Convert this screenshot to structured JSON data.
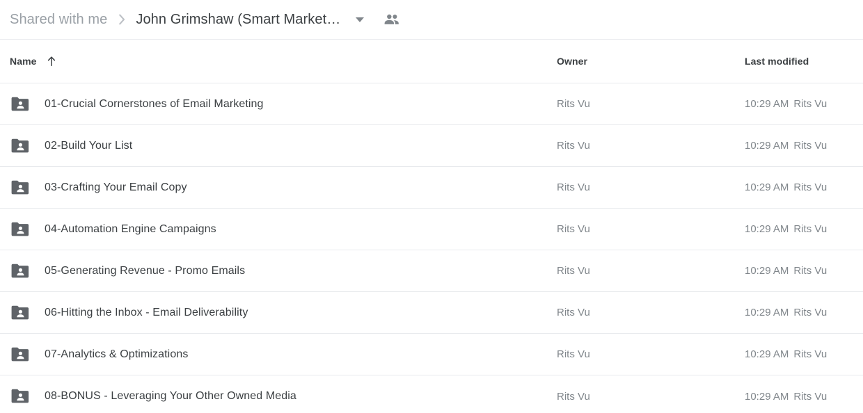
{
  "breadcrumb": {
    "root_label": "Shared with me",
    "separator_icon": "chevron-right-icon",
    "current_label": "John Grimshaw (Smart Market…",
    "caret_icon": "chevron-down-icon",
    "people_icon": "people-shared-icon"
  },
  "columns": {
    "name_label": "Name",
    "sort_icon": "arrow-up-icon",
    "owner_label": "Owner",
    "modified_label": "Last modified"
  },
  "colors": {
    "text_primary": "#3c4043",
    "text_secondary": "#80868b",
    "divider": "#e8eaed",
    "folder_icon": "#5f6368",
    "background": "#ffffff"
  },
  "rows": [
    {
      "icon": "shared-folder-icon",
      "name": "01-Crucial Cornerstones of Email Marketing",
      "owner": "Rits Vu",
      "modified_time": "10:29 AM",
      "modified_by": "Rits Vu"
    },
    {
      "icon": "shared-folder-icon",
      "name": "02-Build Your List",
      "owner": "Rits Vu",
      "modified_time": "10:29 AM",
      "modified_by": "Rits Vu"
    },
    {
      "icon": "shared-folder-icon",
      "name": "03-Crafting Your Email Copy",
      "owner": "Rits Vu",
      "modified_time": "10:29 AM",
      "modified_by": "Rits Vu"
    },
    {
      "icon": "shared-folder-icon",
      "name": "04-Automation Engine Campaigns",
      "owner": "Rits Vu",
      "modified_time": "10:29 AM",
      "modified_by": "Rits Vu"
    },
    {
      "icon": "shared-folder-icon",
      "name": "05-Generating Revenue - Promo Emails",
      "owner": "Rits Vu",
      "modified_time": "10:29 AM",
      "modified_by": "Rits Vu"
    },
    {
      "icon": "shared-folder-icon",
      "name": "06-Hitting the Inbox - Email Deliverability",
      "owner": "Rits Vu",
      "modified_time": "10:29 AM",
      "modified_by": "Rits Vu"
    },
    {
      "icon": "shared-folder-icon",
      "name": "07-Analytics & Optimizations",
      "owner": "Rits Vu",
      "modified_time": "10:29 AM",
      "modified_by": "Rits Vu"
    },
    {
      "icon": "shared-folder-icon",
      "name": "08-BONUS - Leveraging Your Other Owned Media",
      "owner": "Rits Vu",
      "modified_time": "10:29 AM",
      "modified_by": "Rits Vu"
    }
  ]
}
